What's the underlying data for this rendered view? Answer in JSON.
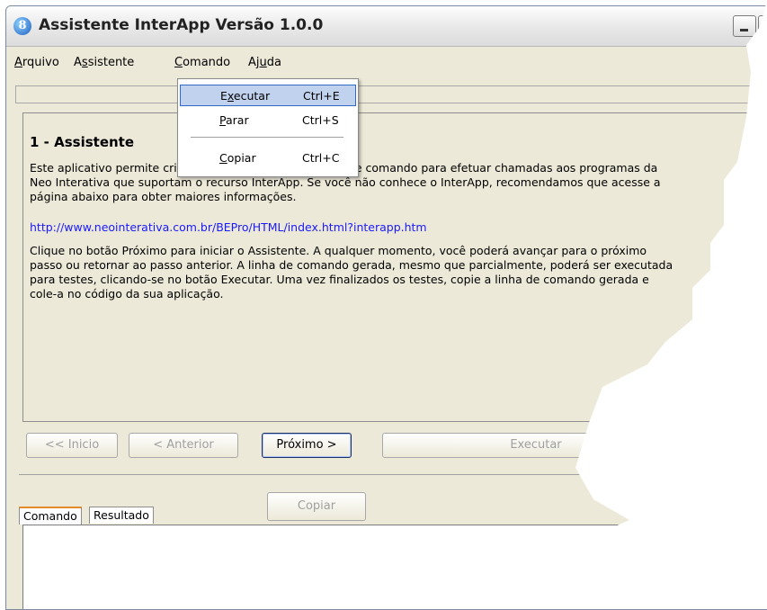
{
  "window": {
    "title": "Assistente InterApp Versão 1.0.0"
  },
  "menu": {
    "items": [
      {
        "pre": "",
        "u": "A",
        "post": "rquivo"
      },
      {
        "pre": "A",
        "u": "s",
        "post": "sistente"
      },
      {
        "pre": "",
        "u": "C",
        "post": "omando"
      },
      {
        "pre": "Aj",
        "u": "u",
        "post": "da"
      }
    ]
  },
  "dropdown": {
    "items": [
      {
        "pre": "E",
        "u": "x",
        "post": "ecutar",
        "shortcut": "Ctrl+E",
        "highlighted": true
      },
      {
        "pre": "",
        "u": "P",
        "post": "arar",
        "shortcut": "Ctrl+S",
        "highlighted": false
      },
      {
        "pre": "",
        "u": "C",
        "post": "opiar",
        "shortcut": "Ctrl+C",
        "highlighted": false
      }
    ]
  },
  "content": {
    "heading": "1 - Assistente",
    "para1": "Este aplicativo permite criar, de forma interativa, linhas de comando para efetuar chamadas aos programas da Neo Interativa que suportam o recurso InterApp. Se você não conhece o InterApp, recomendamos que acesse a página abaixo para obter maiores informações.",
    "link": "http://www.neointerativa.com.br/BEPro/HTML/index.html?interapp.htm",
    "para2": "Clique no botão Próximo para iniciar o Assistente. A qualquer momento, você poderá avançar para o próximo passo ou retornar ao passo anterior. A linha de comando gerada, mesmo que parcialmente, poderá ser executada para testes, clicando-se no botão Executar. Uma vez finalizados os testes, copie a linha de comando gerada e cole-a no código da sua aplicação."
  },
  "buttons": {
    "inicio": "<< Inicio",
    "anterior": "< Anterior",
    "proximo": "Próximo >",
    "executar": "Executar",
    "copiar": "Copiar"
  },
  "tabs": {
    "comando": "Comando",
    "resultado": "Resultado"
  }
}
